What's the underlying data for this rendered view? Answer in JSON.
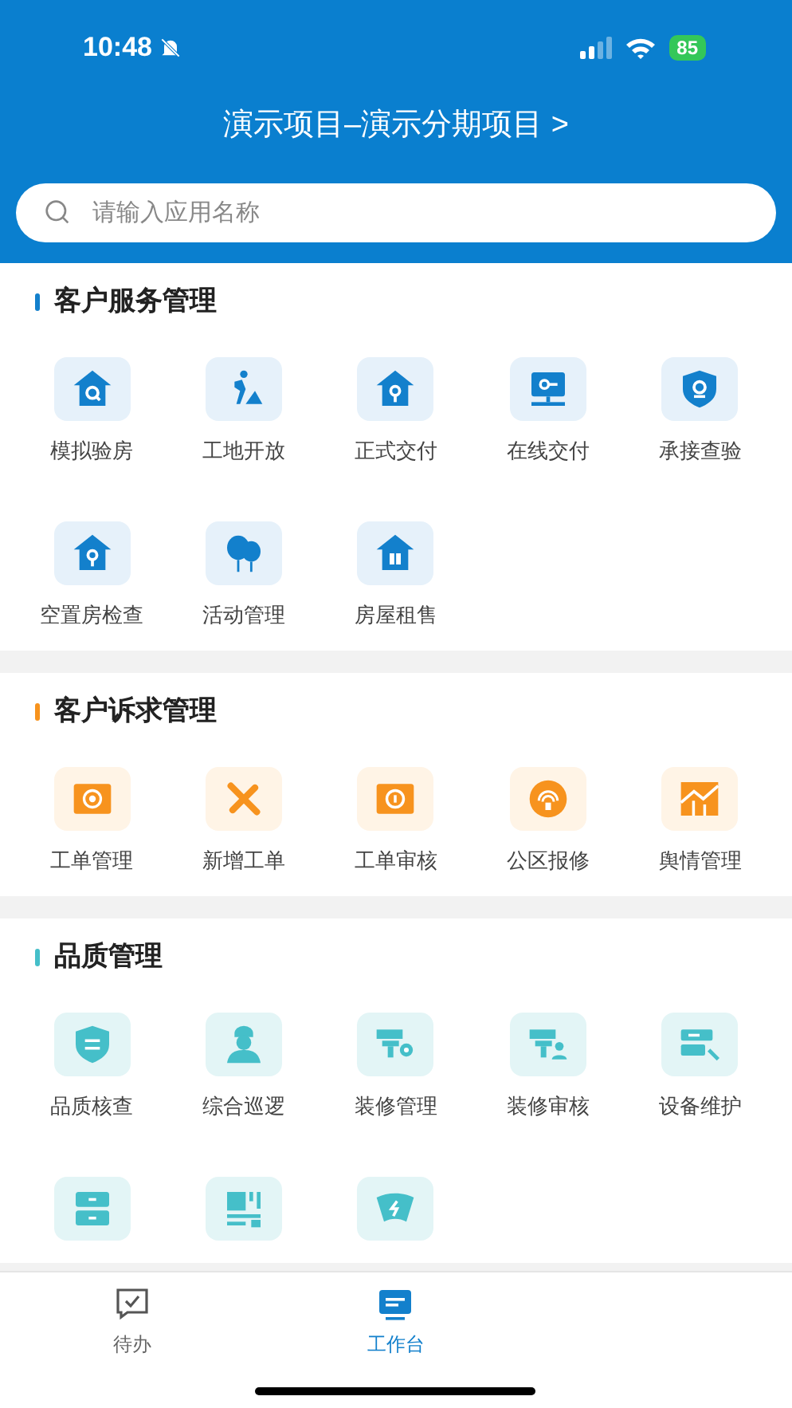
{
  "status_bar": {
    "time": "10:48",
    "battery": "85"
  },
  "header": {
    "title": "演示项目–演示分期项目 >",
    "search": {
      "placeholder": "请输入应用名称"
    }
  },
  "sections": [
    {
      "title": "客户服务管理",
      "color": "#1380cc",
      "items": [
        {
          "kind": "app",
          "label": "模拟验房"
        },
        {
          "kind": "app",
          "label": "工地开放"
        },
        {
          "kind": "app",
          "label": "正式交付"
        },
        {
          "kind": "app",
          "label": "在线交付"
        },
        {
          "kind": "app",
          "label": "承接查验"
        },
        {
          "kind": "app",
          "label": "空置房检查"
        },
        {
          "kind": "app",
          "label": "活动管理"
        },
        {
          "kind": "app",
          "label": "房屋租售"
        }
      ]
    },
    {
      "title": "客户诉求管理",
      "color": "#f7931e",
      "items": [
        {
          "kind": "app",
          "label": "工单管理"
        },
        {
          "kind": "app",
          "label": "新增工单"
        },
        {
          "kind": "app",
          "label": "工单审核"
        },
        {
          "kind": "app",
          "label": "公区报修"
        },
        {
          "kind": "app",
          "label": "舆情管理"
        }
      ]
    },
    {
      "title": "品质管理",
      "color": "#45bfc9",
      "items": [
        {
          "kind": "app",
          "label": "品质核查"
        },
        {
          "kind": "app",
          "label": "综合巡逻"
        },
        {
          "kind": "app",
          "label": "装修管理"
        },
        {
          "kind": "app",
          "label": "装修审核"
        },
        {
          "kind": "app",
          "label": "设备维护"
        },
        {
          "kind": "app-cut"
        },
        {
          "kind": "app-cut"
        },
        {
          "kind": "app-cut"
        }
      ]
    }
  ],
  "tab_bar": [
    {
      "label": "待办",
      "selected": false
    },
    {
      "label": "工作台",
      "selected": true
    }
  ]
}
